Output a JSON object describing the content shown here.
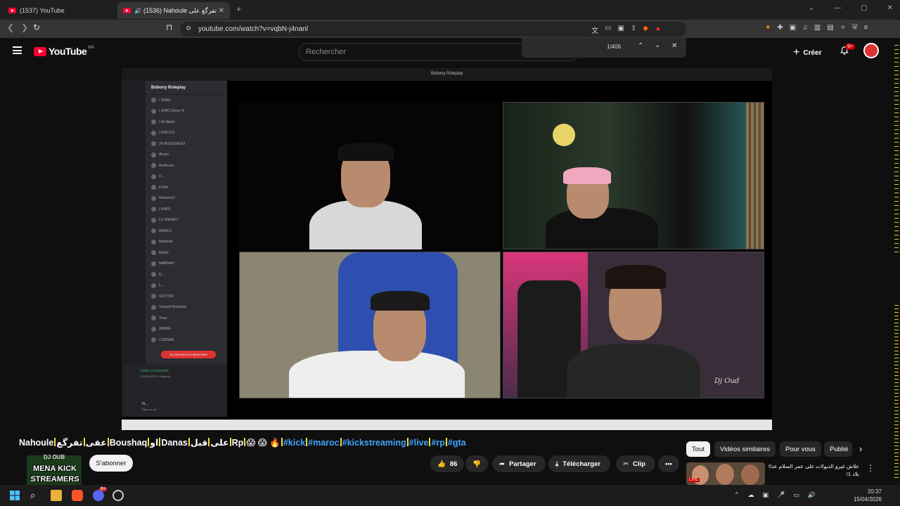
{
  "browser": {
    "tabs": [
      {
        "label": "(1537) YouTube",
        "active": false
      },
      {
        "label": "(1536) Nahoule تفرگع على Bo...",
        "active": true
      }
    ],
    "new_tab_symbol": "+",
    "url": "youtube.com/watch?v=vqbN-j4nanl",
    "find": {
      "count": "1/406"
    }
  },
  "youtube": {
    "logo_text": "YouTube",
    "country": "MA",
    "search_placeholder": "Rechercher",
    "create_label": "Créer",
    "notifications": "9+"
  },
  "video": {
    "discord": {
      "window_title": "Bobony Roleplay",
      "server_name": "Bobony Roleplay",
      "members": [
        "I SSRD",
        "I SIMO Drees %",
        "I All Weird",
        "I KATOXX",
        "24 MOUSSAOUI",
        "Alvaro",
        "Anderson",
        "D...",
        "EVAA",
        "Hebsen23",
        "LHINDI",
        "LS SNEAKY",
        "MADEX",
        "Madarab",
        "Mulah",
        "NAWNAH",
        "N...",
        "L...",
        "VECTOR",
        "Youssef Boushaq",
        "Yusa",
        "ZAWAF",
        "CORSAN"
      ],
      "new_mentions": "112 NOUVELLES MENTIONS",
      "voice_status": "Vidéo connectée",
      "voice_channel": "# SUPPORT 5 / Bobony ...",
      "user_name": "N...",
      "user_status": "Dans un ca"
    },
    "watermark": "Dj Oud"
  },
  "watch": {
    "title_parts": [
      {
        "text": "Nahoule",
        "tag": false
      },
      {
        "text": "عقى",
        "tag": false
      },
      {
        "text": "تفرگع",
        "tag": false
      },
      {
        "text": "Boushaq",
        "tag": false
      },
      {
        "text": "او",
        "tag": false
      },
      {
        "text": "Danas",
        "tag": false
      },
      {
        "text": "على",
        "tag": false
      },
      {
        "text": "قبل",
        "tag": false
      },
      {
        "text": "Rp",
        "tag": false
      },
      {
        "text": "😱 😱 🔥",
        "tag": false
      },
      {
        "text": "#kick",
        "tag": true
      },
      {
        "text": "#maroc",
        "tag": true
      },
      {
        "text": "#kickstreaming",
        "tag": true
      },
      {
        "text": "#live",
        "tag": true
      },
      {
        "text": "#rp",
        "tag": true
      },
      {
        "text": "#gta",
        "tag": true
      }
    ],
    "channel_name": "DJ OUB",
    "channel_logo_lines": [
      "MENA KICK",
      "STREAMERS"
    ],
    "subscribe_label": "S'abonner",
    "like_count": "86",
    "share_label": "Partager",
    "download_label": "Télécharger",
    "clip_label": "Clip",
    "more_label": "•••"
  },
  "recommendations": {
    "chips": [
      "Tout",
      "Vidéos similaires",
      "Pour vous",
      "Publié"
    ],
    "first_title": "علاش غيرو الديولات على عمر السلام عدا! بلاد 1!",
    "thumbnail_label": "LIVE"
  },
  "taskbar": {
    "time": "20:37",
    "date": "15/04/2026",
    "badge": "9+"
  }
}
